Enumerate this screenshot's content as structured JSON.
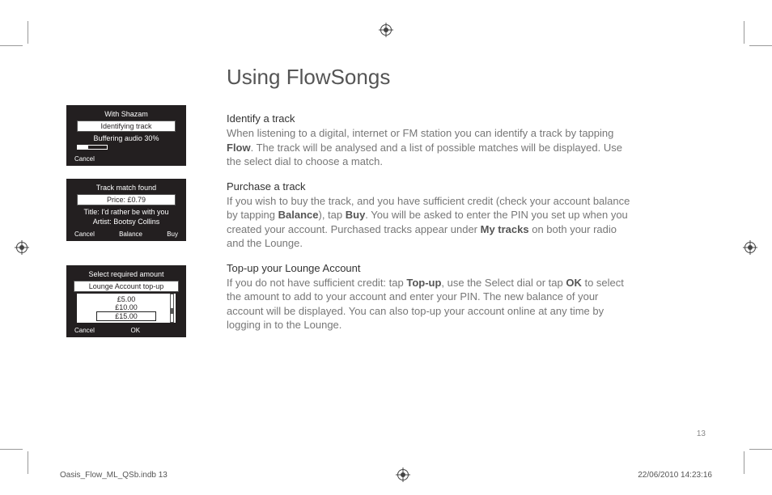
{
  "marks": {},
  "title": "Using FlowSongs",
  "screens": {
    "s1": {
      "line1": "With Shazam",
      "box": "Identifying track",
      "line2": "Buffering audio 30%",
      "cancel": "Cancel"
    },
    "s2": {
      "line1": "Track match found",
      "box": "Price: £0.79",
      "title": "Title: I'd rather be with you",
      "artist": "Artist: Bootsy Collins",
      "cancel": "Cancel",
      "balance": "Balance",
      "buy": "Buy"
    },
    "s3": {
      "line1": "Select required amount",
      "box": "Lounge Account top-up",
      "amt1": "£5.00",
      "amt2": "£10.00",
      "amt3": "£15.00",
      "cancel": "Cancel",
      "ok": "OK"
    }
  },
  "sections": {
    "identify": {
      "heading": "Identify a track",
      "p1a": "When listening to a digital, internet or FM station you can identify a track by tapping ",
      "p1b": "Flow",
      "p1c": ". The track will be analysed and a list of possible matches will be displayed. Use the select dial to choose a match."
    },
    "purchase": {
      "heading": "Purchase a track",
      "p1a": "If you wish to buy the track, and you have sufficient credit (check your account balance by tapping ",
      "p1b": "Balance",
      "p1c": "), tap ",
      "p1d": "Buy",
      "p1e": ". You will be asked to enter the PIN you set up when you created your account. Purchased tracks appear under ",
      "p1f": "My tracks",
      "p1g": " on both your radio and the Lounge."
    },
    "topup": {
      "heading": "Top-up your Lounge Account",
      "p1a": "If you do not have sufficient credit: tap ",
      "p1b": "Top-up",
      "p1c": ", use the Select dial or tap ",
      "p1d": "OK",
      "p1e": " to select the amount to add to your account and enter your PIN. The new balance of your account will be displayed. You can also top-up your account online at any time by logging in to the Lounge."
    }
  },
  "pagenum": "13",
  "footer": {
    "file": "Oasis_Flow_ML_QSb.indb   13",
    "date": "22/06/2010   14:23:16"
  }
}
